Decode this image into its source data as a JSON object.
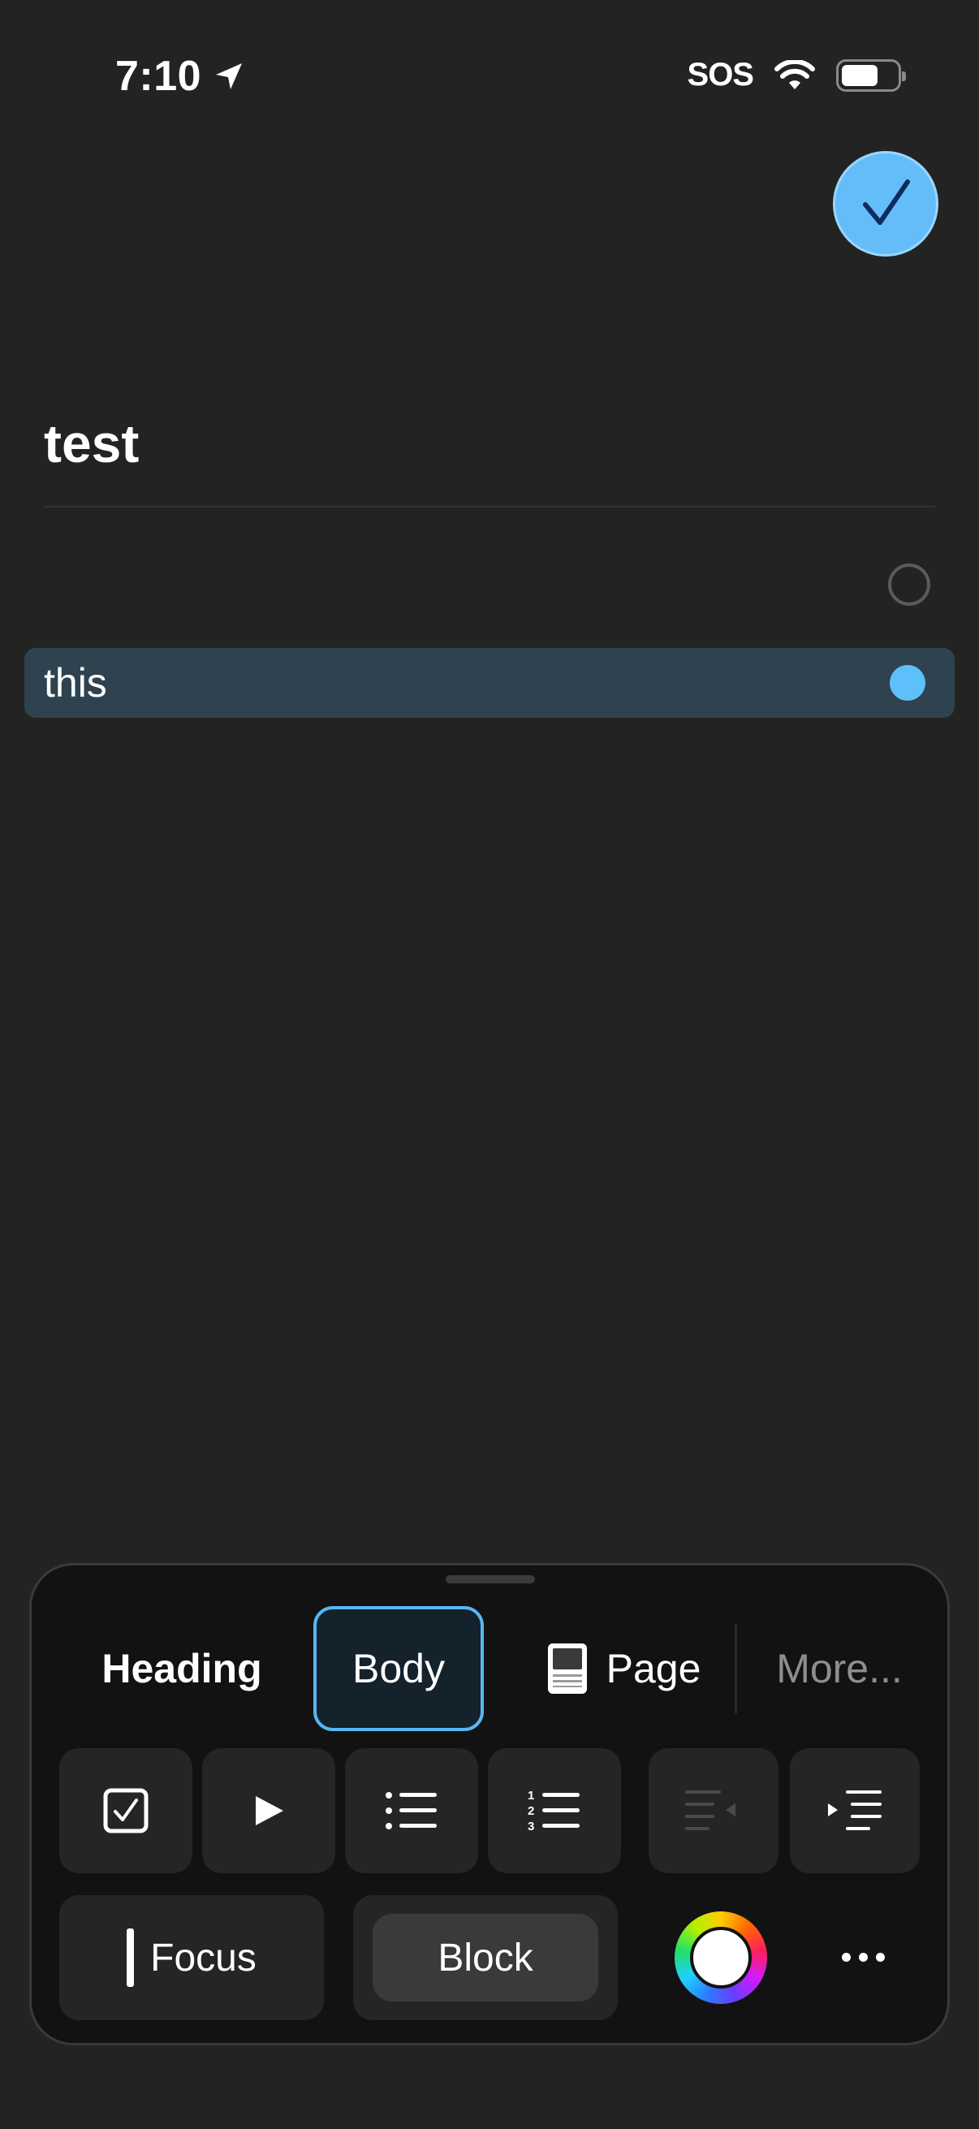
{
  "status_bar": {
    "time": "7:10",
    "carrier": "SOS"
  },
  "note": {
    "title": "test",
    "rows": [
      {
        "text": "",
        "selected": false
      },
      {
        "text": "this",
        "selected": true
      }
    ]
  },
  "format_panel": {
    "styles": {
      "heading": "Heading",
      "body": "Body",
      "page": "Page",
      "more": "More..."
    },
    "selected_style": "Body",
    "tools": [
      {
        "name": "checklist-icon"
      },
      {
        "name": "toggle-icon"
      },
      {
        "name": "bulleted-list-icon"
      },
      {
        "name": "numbered-list-icon"
      },
      {
        "name": "outdent-icon"
      },
      {
        "name": "indent-icon"
      }
    ],
    "focus_label": "Focus",
    "block_label": "Block"
  },
  "colors": {
    "background": "#232323",
    "accent": "#5ec0fa",
    "selected_row": "#2f424f",
    "panel": "#121212"
  }
}
